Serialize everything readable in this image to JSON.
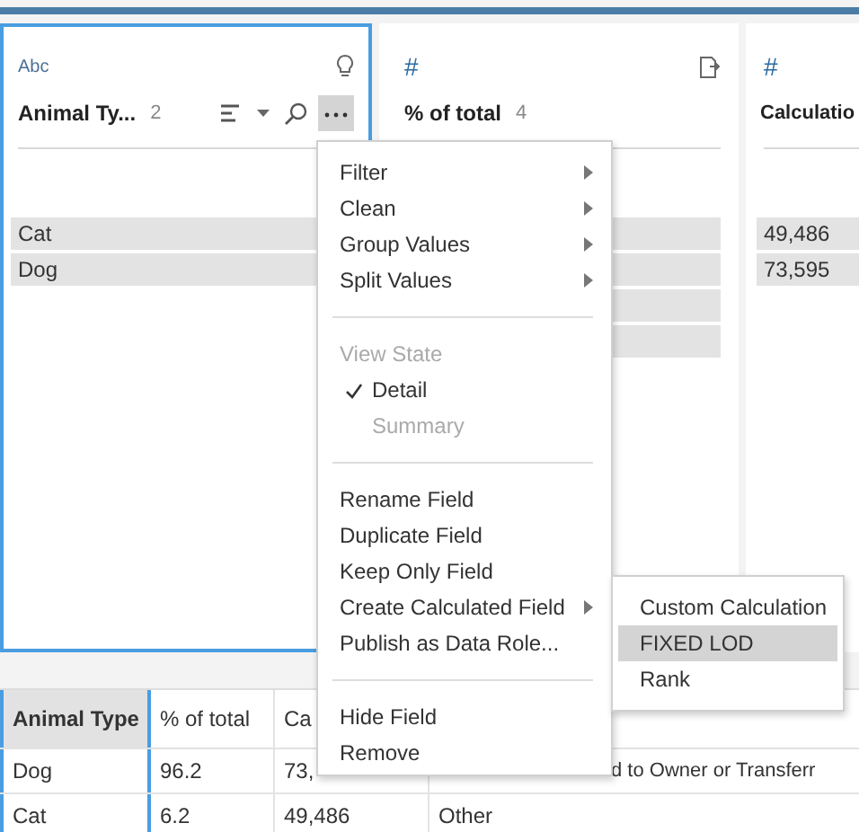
{
  "fields": [
    {
      "type_label": "Abc",
      "name": "Animal Ty...",
      "count": "2",
      "selected": true,
      "values": [
        "Cat",
        "Dog"
      ]
    },
    {
      "type_label": "#",
      "name": "% of total",
      "count": "4",
      "selected": false
    },
    {
      "type_label": "#",
      "name": "Calculatio",
      "selected": false,
      "values": [
        "49,486",
        "73,595"
      ]
    }
  ],
  "menu": [
    {
      "kind": "item",
      "label": "Filter",
      "submenu": true
    },
    {
      "kind": "item",
      "label": "Clean",
      "submenu": true
    },
    {
      "kind": "item",
      "label": "Group Values",
      "submenu": true
    },
    {
      "kind": "item",
      "label": "Split Values",
      "submenu": true
    },
    {
      "kind": "separator"
    },
    {
      "kind": "item",
      "label": "View State",
      "disabled": true
    },
    {
      "kind": "item",
      "label": "Detail",
      "checked": true
    },
    {
      "kind": "item",
      "label": "Summary",
      "disabled": true,
      "checked": false
    },
    {
      "kind": "separator"
    },
    {
      "kind": "item",
      "label": "Rename Field"
    },
    {
      "kind": "item",
      "label": "Duplicate Field"
    },
    {
      "kind": "item",
      "label": "Keep Only Field"
    },
    {
      "kind": "item",
      "label": "Create Calculated Field",
      "submenu": true,
      "expanded": true
    },
    {
      "kind": "item",
      "label": "Publish as Data Role..."
    },
    {
      "kind": "separator"
    },
    {
      "kind": "item",
      "label": "Hide Field"
    },
    {
      "kind": "item",
      "label": "Remove"
    }
  ],
  "submenu": [
    {
      "label": "Custom Calculation",
      "selected": false
    },
    {
      "label": "FIXED LOD",
      "selected": true
    },
    {
      "label": "Rank",
      "selected": false
    }
  ],
  "table": {
    "columns": [
      {
        "label": "Animal Type",
        "selected": true
      },
      {
        "label": "% of total",
        "selected": false
      },
      {
        "label": "Ca",
        "selected": false
      }
    ],
    "rows": [
      [
        "Dog",
        "96.2",
        "73,",
        "d to Owner or Transferr"
      ],
      [
        "Cat",
        "6.2",
        "49,486",
        "Other"
      ]
    ]
  }
}
